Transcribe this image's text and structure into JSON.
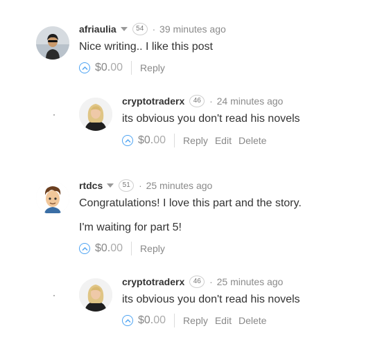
{
  "comments": [
    {
      "author": "afriaulia",
      "reputation": "54",
      "time": "39 minutes ago",
      "body": [
        "Nice writing.. I like this post"
      ],
      "payout_whole": "$0.",
      "payout_cents": "00",
      "actions": [
        "Reply"
      ]
    },
    {
      "author": "cryptotraderx",
      "reputation": "46",
      "time": "24 minutes ago",
      "body": [
        "its obvious you don't read his novels"
      ],
      "payout_whole": "$0.",
      "payout_cents": "00",
      "actions": [
        "Reply",
        "Edit",
        "Delete"
      ]
    },
    {
      "author": "rtdcs",
      "reputation": "51",
      "time": "25 minutes ago",
      "body": [
        "Congratulations! I love this part and the story.",
        "I'm waiting for part 5!"
      ],
      "payout_whole": "$0.",
      "payout_cents": "00",
      "actions": [
        "Reply"
      ]
    },
    {
      "author": "cryptotraderx",
      "reputation": "46",
      "time": "25 minutes ago",
      "body": [
        "its obvious you don't read his novels"
      ],
      "payout_whole": "$0.",
      "payout_cents": "00",
      "actions": [
        "Reply",
        "Edit",
        "Delete"
      ]
    }
  ],
  "colors": {
    "vote_blue": "#4ba2f2",
    "text": "#333333",
    "muted": "#888888"
  }
}
